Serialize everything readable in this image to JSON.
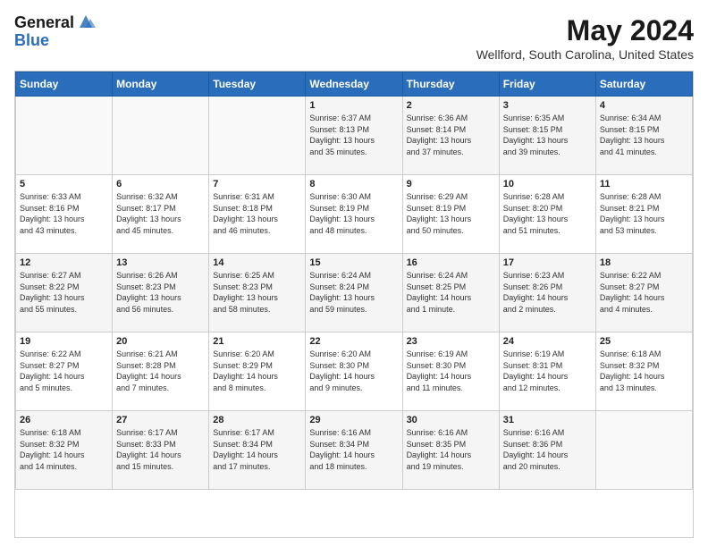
{
  "header": {
    "logo_general": "General",
    "logo_blue": "Blue",
    "title": "May 2024",
    "location": "Wellford, South Carolina, United States"
  },
  "days_of_week": [
    "Sunday",
    "Monday",
    "Tuesday",
    "Wednesday",
    "Thursday",
    "Friday",
    "Saturday"
  ],
  "weeks": [
    [
      {
        "day": "",
        "info": ""
      },
      {
        "day": "",
        "info": ""
      },
      {
        "day": "",
        "info": ""
      },
      {
        "day": "1",
        "info": "Sunrise: 6:37 AM\nSunset: 8:13 PM\nDaylight: 13 hours\nand 35 minutes."
      },
      {
        "day": "2",
        "info": "Sunrise: 6:36 AM\nSunset: 8:14 PM\nDaylight: 13 hours\nand 37 minutes."
      },
      {
        "day": "3",
        "info": "Sunrise: 6:35 AM\nSunset: 8:15 PM\nDaylight: 13 hours\nand 39 minutes."
      },
      {
        "day": "4",
        "info": "Sunrise: 6:34 AM\nSunset: 8:15 PM\nDaylight: 13 hours\nand 41 minutes."
      }
    ],
    [
      {
        "day": "5",
        "info": "Sunrise: 6:33 AM\nSunset: 8:16 PM\nDaylight: 13 hours\nand 43 minutes."
      },
      {
        "day": "6",
        "info": "Sunrise: 6:32 AM\nSunset: 8:17 PM\nDaylight: 13 hours\nand 45 minutes."
      },
      {
        "day": "7",
        "info": "Sunrise: 6:31 AM\nSunset: 8:18 PM\nDaylight: 13 hours\nand 46 minutes."
      },
      {
        "day": "8",
        "info": "Sunrise: 6:30 AM\nSunset: 8:19 PM\nDaylight: 13 hours\nand 48 minutes."
      },
      {
        "day": "9",
        "info": "Sunrise: 6:29 AM\nSunset: 8:19 PM\nDaylight: 13 hours\nand 50 minutes."
      },
      {
        "day": "10",
        "info": "Sunrise: 6:28 AM\nSunset: 8:20 PM\nDaylight: 13 hours\nand 51 minutes."
      },
      {
        "day": "11",
        "info": "Sunrise: 6:28 AM\nSunset: 8:21 PM\nDaylight: 13 hours\nand 53 minutes."
      }
    ],
    [
      {
        "day": "12",
        "info": "Sunrise: 6:27 AM\nSunset: 8:22 PM\nDaylight: 13 hours\nand 55 minutes."
      },
      {
        "day": "13",
        "info": "Sunrise: 6:26 AM\nSunset: 8:23 PM\nDaylight: 13 hours\nand 56 minutes."
      },
      {
        "day": "14",
        "info": "Sunrise: 6:25 AM\nSunset: 8:23 PM\nDaylight: 13 hours\nand 58 minutes."
      },
      {
        "day": "15",
        "info": "Sunrise: 6:24 AM\nSunset: 8:24 PM\nDaylight: 13 hours\nand 59 minutes."
      },
      {
        "day": "16",
        "info": "Sunrise: 6:24 AM\nSunset: 8:25 PM\nDaylight: 14 hours\nand 1 minute."
      },
      {
        "day": "17",
        "info": "Sunrise: 6:23 AM\nSunset: 8:26 PM\nDaylight: 14 hours\nand 2 minutes."
      },
      {
        "day": "18",
        "info": "Sunrise: 6:22 AM\nSunset: 8:27 PM\nDaylight: 14 hours\nand 4 minutes."
      }
    ],
    [
      {
        "day": "19",
        "info": "Sunrise: 6:22 AM\nSunset: 8:27 PM\nDaylight: 14 hours\nand 5 minutes."
      },
      {
        "day": "20",
        "info": "Sunrise: 6:21 AM\nSunset: 8:28 PM\nDaylight: 14 hours\nand 7 minutes."
      },
      {
        "day": "21",
        "info": "Sunrise: 6:20 AM\nSunset: 8:29 PM\nDaylight: 14 hours\nand 8 minutes."
      },
      {
        "day": "22",
        "info": "Sunrise: 6:20 AM\nSunset: 8:30 PM\nDaylight: 14 hours\nand 9 minutes."
      },
      {
        "day": "23",
        "info": "Sunrise: 6:19 AM\nSunset: 8:30 PM\nDaylight: 14 hours\nand 11 minutes."
      },
      {
        "day": "24",
        "info": "Sunrise: 6:19 AM\nSunset: 8:31 PM\nDaylight: 14 hours\nand 12 minutes."
      },
      {
        "day": "25",
        "info": "Sunrise: 6:18 AM\nSunset: 8:32 PM\nDaylight: 14 hours\nand 13 minutes."
      }
    ],
    [
      {
        "day": "26",
        "info": "Sunrise: 6:18 AM\nSunset: 8:32 PM\nDaylight: 14 hours\nand 14 minutes."
      },
      {
        "day": "27",
        "info": "Sunrise: 6:17 AM\nSunset: 8:33 PM\nDaylight: 14 hours\nand 15 minutes."
      },
      {
        "day": "28",
        "info": "Sunrise: 6:17 AM\nSunset: 8:34 PM\nDaylight: 14 hours\nand 17 minutes."
      },
      {
        "day": "29",
        "info": "Sunrise: 6:16 AM\nSunset: 8:34 PM\nDaylight: 14 hours\nand 18 minutes."
      },
      {
        "day": "30",
        "info": "Sunrise: 6:16 AM\nSunset: 8:35 PM\nDaylight: 14 hours\nand 19 minutes."
      },
      {
        "day": "31",
        "info": "Sunrise: 6:16 AM\nSunset: 8:36 PM\nDaylight: 14 hours\nand 20 minutes."
      },
      {
        "day": "",
        "info": ""
      }
    ]
  ]
}
